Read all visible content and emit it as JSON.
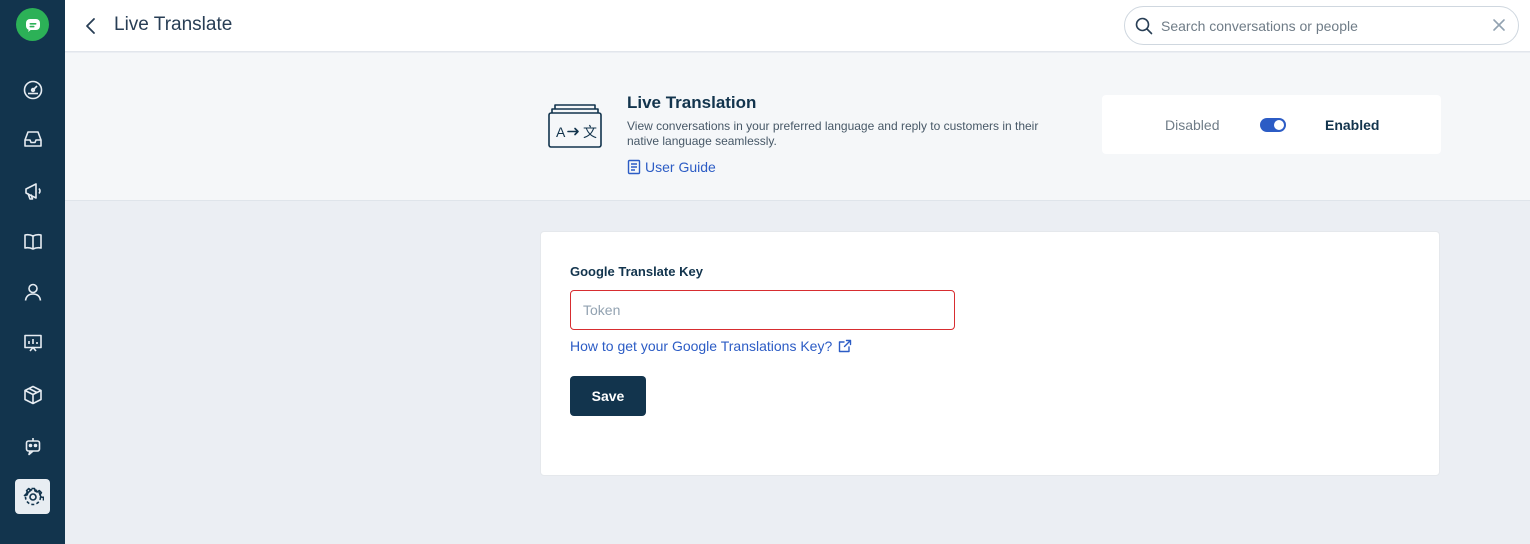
{
  "header": {
    "title": "Live Translate",
    "search_placeholder": "Search conversations or people"
  },
  "sidebar": {
    "items": [
      {
        "icon": "dashboard-icon"
      },
      {
        "icon": "inbox-icon"
      },
      {
        "icon": "megaphone-icon"
      },
      {
        "icon": "book-icon"
      },
      {
        "icon": "contact-icon"
      },
      {
        "icon": "reports-icon"
      },
      {
        "icon": "cube-icon"
      },
      {
        "icon": "bot-icon"
      },
      {
        "icon": "gear-icon",
        "active": true
      }
    ]
  },
  "app": {
    "name": "Live Translation",
    "description": "View conversations in your preferred language and reply to customers in their native language seamlessly.",
    "guide_label": "User Guide",
    "status_off_label": "Disabled",
    "status_on_label": "Enabled",
    "enabled": true
  },
  "form": {
    "field_label": "Google Translate Key",
    "token_placeholder": "Token",
    "token_value": "",
    "help_link": "How to get your Google Translations Key?",
    "save_label": "Save"
  },
  "colors": {
    "sidebar": "#12344d",
    "brand_green": "#2cb157",
    "link": "#2c5cc5",
    "error_border": "#d72d30",
    "primary_button": "#12344d"
  }
}
